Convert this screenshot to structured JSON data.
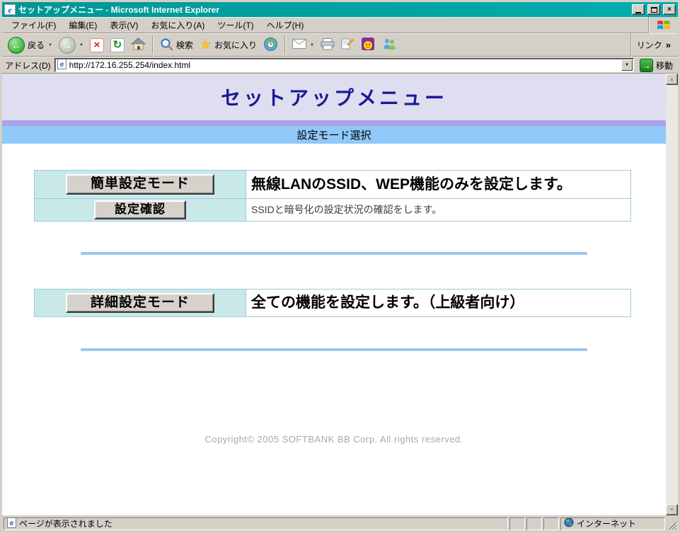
{
  "window": {
    "title": "セットアップメニュー - Microsoft Internet Explorer"
  },
  "menu_bar": {
    "items": [
      "ファイル(F)",
      "編集(E)",
      "表示(V)",
      "お気に入り(A)",
      "ツール(T)",
      "ヘルプ(H)"
    ]
  },
  "toolbar": {
    "back_label": "戻る",
    "search_label": "検索",
    "favorites_label": "お気に入り",
    "links_label": "リンク",
    "links_chevron": "»"
  },
  "address_bar": {
    "label": "アドレス(D)",
    "url": "http://172.16.255.254/index.html",
    "go_label": "移動"
  },
  "page": {
    "title": "セットアップメニュー",
    "section_header": "設定モード選択",
    "simple_section": {
      "mode_button": "簡単設定モード",
      "mode_description": "無線LANのSSID、WEP機能のみを設定します。",
      "check_button": "設定確認",
      "check_description": "SSIDと暗号化の設定状況の確認をします。"
    },
    "detail_section": {
      "mode_button": "詳細設定モード",
      "mode_description": "全ての機能を設定します。（上級者向け）"
    },
    "copyright": "Copyright© 2005 SOFTBANK BB Corp. All rights reserved."
  },
  "status_bar": {
    "message": "ページが表示されました",
    "zone": "インターネット"
  },
  "icons": {
    "ie_glyph": "e",
    "back_arrow": "←",
    "forward_arrow": "→",
    "stop_glyph": "×",
    "refresh_glyph": "↻",
    "dropdown_glyph": "▼",
    "star_glyph": "★",
    "go_arrow": "→",
    "close_glyph": "×",
    "scroll_up": "▲",
    "scroll_down": "▼"
  },
  "colors": {
    "titlebar": "#00A2A2",
    "chrome": "#D4D0C8",
    "page_title_text": "#1A1A99",
    "header_band": "#DEDEF0",
    "purple_stripe": "#A9A2E8",
    "section_bar": "#90C8F8",
    "button_cell": "#C9E9E9",
    "table_border": "#A0C8DC",
    "divider": "#A0C6EC"
  }
}
